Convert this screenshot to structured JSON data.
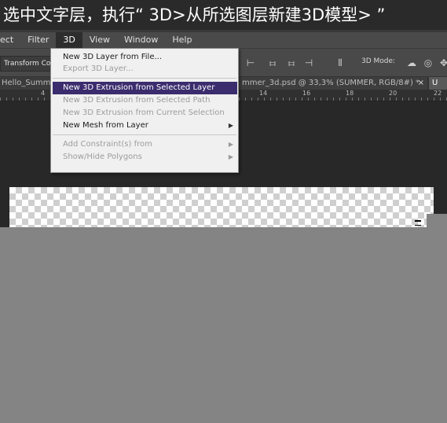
{
  "caption": "选中文字层，执行“ 3D>从所选图层新建3D模型> ”",
  "menubar": {
    "items": [
      "ect",
      "Filter",
      "3D",
      "View",
      "Window",
      "Help"
    ],
    "active_index": 2
  },
  "options": {
    "transform_button": "Transform Con",
    "mode_label": "3D Mode:"
  },
  "tabs": {
    "left": "Hello_Summe",
    "doc": "mmer_3d.psd @ 33,3% (SUMMER, RGB/8#) *",
    "close": "×",
    "right": "U"
  },
  "ruler": {
    "labels": [
      "4",
      "14",
      "16",
      "18",
      "20",
      "22"
    ]
  },
  "dropdown": {
    "group1": [
      {
        "label": "New 3D Layer from File...",
        "disabled": false
      },
      {
        "label": "Export 3D Layer...",
        "disabled": true
      }
    ],
    "group2": [
      {
        "label": "New 3D Extrusion from Selected Layer",
        "disabled": false,
        "highlighted": true
      },
      {
        "label": "New 3D Extrusion from Selected Path",
        "disabled": true
      },
      {
        "label": "New 3D Extrusion from Current Selection",
        "disabled": true
      },
      {
        "label": "New Mesh from Layer",
        "disabled": false,
        "submenu": true
      }
    ],
    "group3": [
      {
        "label": "Add Constraint(s) from",
        "disabled": true,
        "submenu": true
      },
      {
        "label": "Show/Hide Polygons",
        "disabled": true,
        "submenu": true
      }
    ],
    "submenu_arrow": "▶"
  }
}
